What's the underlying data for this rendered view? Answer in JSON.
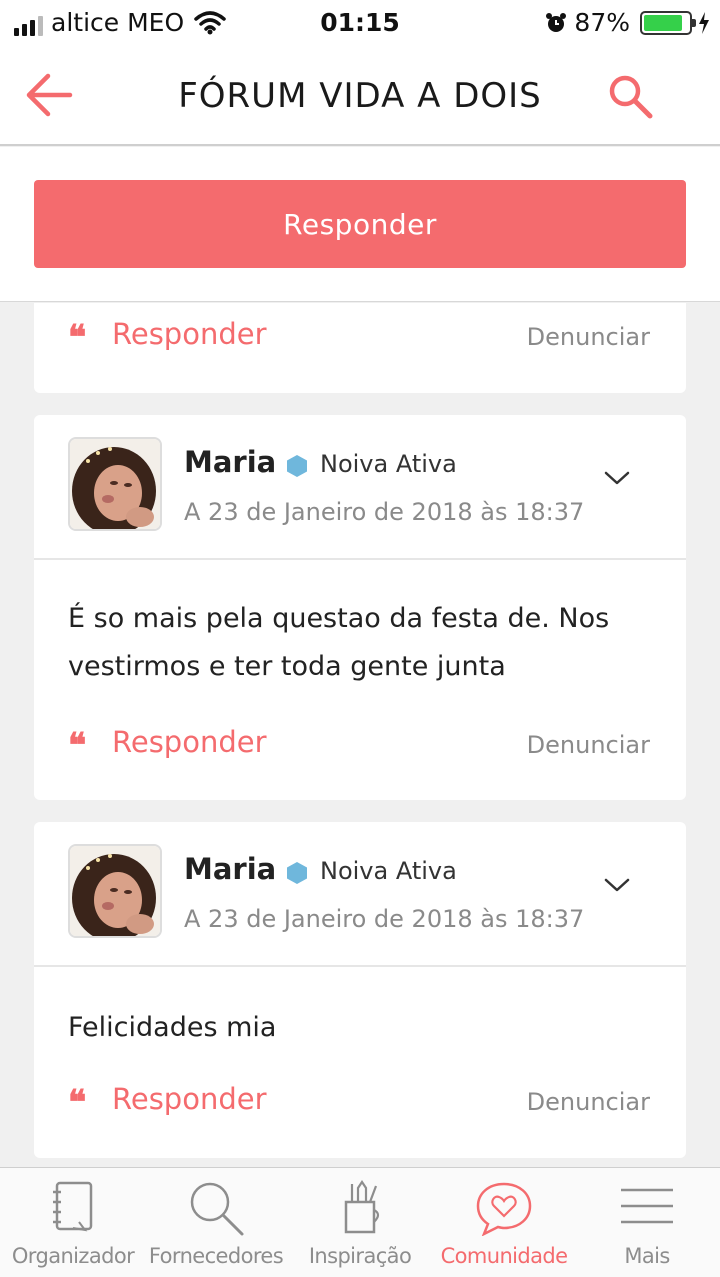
{
  "status_bar": {
    "carrier": "altice MEO",
    "time": "01:15",
    "battery": "87%",
    "battery_level": 0.87
  },
  "header": {
    "title": "FÓRUM VIDA A DOIS",
    "back_icon": "arrow-left-icon",
    "search_icon": "search-icon"
  },
  "reply_button": {
    "label": "Responder"
  },
  "feed": {
    "top_card": {
      "respond_label": "Responder",
      "report_label": "Denunciar"
    },
    "posts": [
      {
        "author": "Maria",
        "badge": "Noiva Ativa",
        "date": "A 23 de Janeiro de 2018 às 18:37",
        "body": "É so mais pela questao da festa de. Nos vestirmos e ter toda gente junta",
        "respond_label": "Responder",
        "report_label": "Denunciar"
      },
      {
        "author": "Maria",
        "badge": "Noiva Ativa",
        "date": "A 23 de Janeiro de 2018 às 18:37",
        "body": "Felicidades mia",
        "respond_label": "Responder",
        "report_label": "Denunciar"
      }
    ]
  },
  "tabbar": {
    "tabs": [
      {
        "label": "Organizador",
        "icon": "notebook-icon"
      },
      {
        "label": "Fornecedores",
        "icon": "magnifier-icon"
      },
      {
        "label": "Inspiração",
        "icon": "pencil-cup-icon"
      },
      {
        "label": "Comunidade",
        "icon": "chat-heart-icon",
        "active": true
      },
      {
        "label": "Mais",
        "icon": "menu-icon"
      }
    ]
  },
  "colors": {
    "accent": "#f46b6e",
    "badge": "#6fb7dc",
    "battery_fill": "#35d04a"
  }
}
